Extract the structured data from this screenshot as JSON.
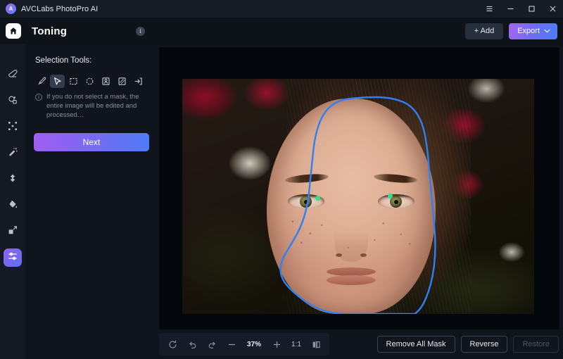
{
  "titlebar": {
    "app_name": "AVCLabs PhotoPro AI",
    "logo_text": "A",
    "menu_icon": "hamburger-menu-icon",
    "minimize_icon": "minimize-icon",
    "maximize_icon": "maximize-icon",
    "close_icon": "close-icon"
  },
  "header": {
    "home_icon": "home-icon",
    "title": "Toning",
    "info_icon": "info-icon",
    "info_glyph": "i",
    "add_label": "+ Add",
    "export_label": "Export",
    "export_chevron": "chevron-down-icon",
    "export_gradient_start": "#a366ef",
    "export_gradient_end": "#4d7ef8"
  },
  "rail": {
    "items": [
      {
        "icon": "eraser-icon",
        "active": false
      },
      {
        "icon": "object-removal-icon",
        "active": false
      },
      {
        "icon": "upscale-expand-icon",
        "active": false
      },
      {
        "icon": "magic-wand-icon",
        "active": false
      },
      {
        "icon": "enhance-sparkle-icon",
        "active": false
      },
      {
        "icon": "color-fill-icon",
        "active": false
      },
      {
        "icon": "resize-icon",
        "active": false
      },
      {
        "icon": "toning-sliders-icon",
        "active": true
      }
    ],
    "active_background": "#7a63f0"
  },
  "panel": {
    "heading": "Selection Tools:",
    "tools": [
      {
        "icon": "brush-tool-icon",
        "selected": false
      },
      {
        "icon": "pointer-select-tool-icon",
        "selected": true
      },
      {
        "icon": "rectangle-select-tool-icon",
        "selected": false
      },
      {
        "icon": "ellipse-select-tool-icon",
        "selected": false
      },
      {
        "icon": "portrait-select-tool-icon",
        "selected": false
      },
      {
        "icon": "background-select-tool-icon",
        "selected": false
      },
      {
        "icon": "import-mask-tool-icon",
        "selected": false
      }
    ],
    "hint_icon": "info-circle-icon",
    "hint_glyph": "i",
    "hint_text": "If you do not select a mask, the entire image will be edited and processed…",
    "next_label": "Next",
    "next_gradient_start": "#a05ff0",
    "next_gradient_end": "#4f7bf7"
  },
  "canvas": {
    "mask_outline_color": "#2f7ff5",
    "eye_marker_color": "#2fe08a",
    "eye_markers": 2
  },
  "bottombar": {
    "reset_icon": "reset-rotate-icon",
    "undo_icon": "undo-icon",
    "redo_icon": "redo-icon",
    "zoom_out_icon": "minus-icon",
    "zoom_level": "37%",
    "zoom_in_icon": "plus-icon",
    "fit_label": "1:1",
    "compare_icon": "split-compare-icon",
    "remove_all_mask_label": "Remove All Mask",
    "reverse_label": "Reverse",
    "restore_label": "Restore",
    "restore_disabled": true
  }
}
